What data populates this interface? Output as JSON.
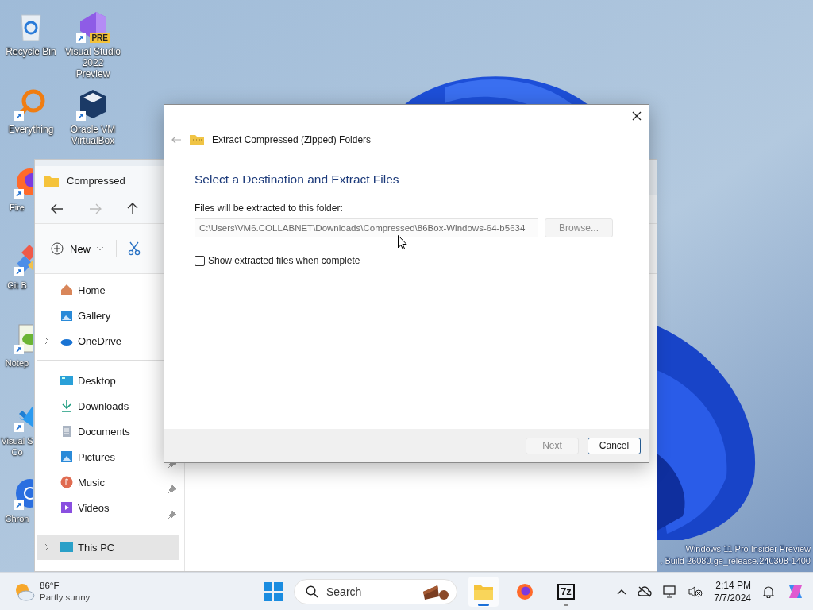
{
  "desktop_icons": [
    {
      "label": "Recycle Bin",
      "kind": "recycle",
      "shortcut": false
    },
    {
      "label": "Visual Studio 2022 Preview",
      "kind": "vs",
      "badge": "PRE",
      "shortcut": true
    },
    {
      "label": "Everything",
      "kind": "everything",
      "shortcut": true
    },
    {
      "label": "Oracle VM VirtualBox",
      "kind": "virtualbox",
      "shortcut": true
    },
    {
      "label": "Fire",
      "kind": "firefox",
      "shortcut": true
    },
    {
      "label": "Git B",
      "kind": "git",
      "shortcut": true
    },
    {
      "label": "Notep",
      "kind": "notepad",
      "shortcut": true
    },
    {
      "label": "Visual S Co",
      "kind": "vscode",
      "shortcut": true
    },
    {
      "label": "Chron",
      "kind": "chrome",
      "shortcut": true
    }
  ],
  "watermark": {
    "line_1": "Windows 11 Pro Insider Preview",
    "line_2": ". Build 26080.ge_release.240308-1400"
  },
  "explorer": {
    "tab_title": "Compressed",
    "new_label": "New",
    "sidebar": [
      [
        {
          "label": "Home",
          "kind": "home",
          "expandable": false,
          "selected": false
        },
        {
          "label": "Gallery",
          "kind": "gallery",
          "expandable": false,
          "selected": false
        },
        {
          "label": "OneDrive",
          "kind": "onedrive",
          "expandable": true,
          "selected": false
        }
      ],
      [
        {
          "label": "Desktop",
          "kind": "desktop",
          "expandable": false,
          "selected": false
        },
        {
          "label": "Downloads",
          "kind": "downloads",
          "expandable": false,
          "selected": false
        },
        {
          "label": "Documents",
          "kind": "documents",
          "expandable": false,
          "selected": false
        },
        {
          "label": "Pictures",
          "kind": "pictures",
          "expandable": false,
          "pinned": true,
          "selected": false
        },
        {
          "label": "Music",
          "kind": "music",
          "expandable": false,
          "pinned": true,
          "selected": false
        },
        {
          "label": "Videos",
          "kind": "videos",
          "expandable": false,
          "pinned": true,
          "selected": false
        }
      ],
      [
        {
          "label": "This PC",
          "kind": "pc",
          "expandable": true,
          "selected": true
        }
      ]
    ]
  },
  "dialog": {
    "title": "Extract Compressed (Zipped) Folders",
    "heading": "Select a Destination and Extract Files",
    "field_label": "Files will be extracted to this folder:",
    "path": "C:\\Users\\VM6.COLLABNET\\Downloads\\Compressed\\86Box-Windows-64-b5634",
    "browse": {
      "label": "Browse...",
      "disabled": true
    },
    "show_files": {
      "label": "Show extracted files when complete",
      "checked": false
    },
    "next": {
      "label": "Next",
      "disabled": true
    },
    "cancel": {
      "label": "Cancel",
      "disabled": false
    }
  },
  "taskbar": {
    "weather": {
      "temperature": "86°F",
      "condition": "Partly sunny"
    },
    "search_placeholder": "Search",
    "apps": [
      {
        "kind": "explorer",
        "active": true,
        "running": true
      },
      {
        "kind": "firefox",
        "active": false,
        "running": false
      },
      {
        "kind": "sevenzip",
        "label": "7z",
        "active": false,
        "running": true
      }
    ],
    "time": "2:14 PM",
    "date": "7/7/2024"
  }
}
